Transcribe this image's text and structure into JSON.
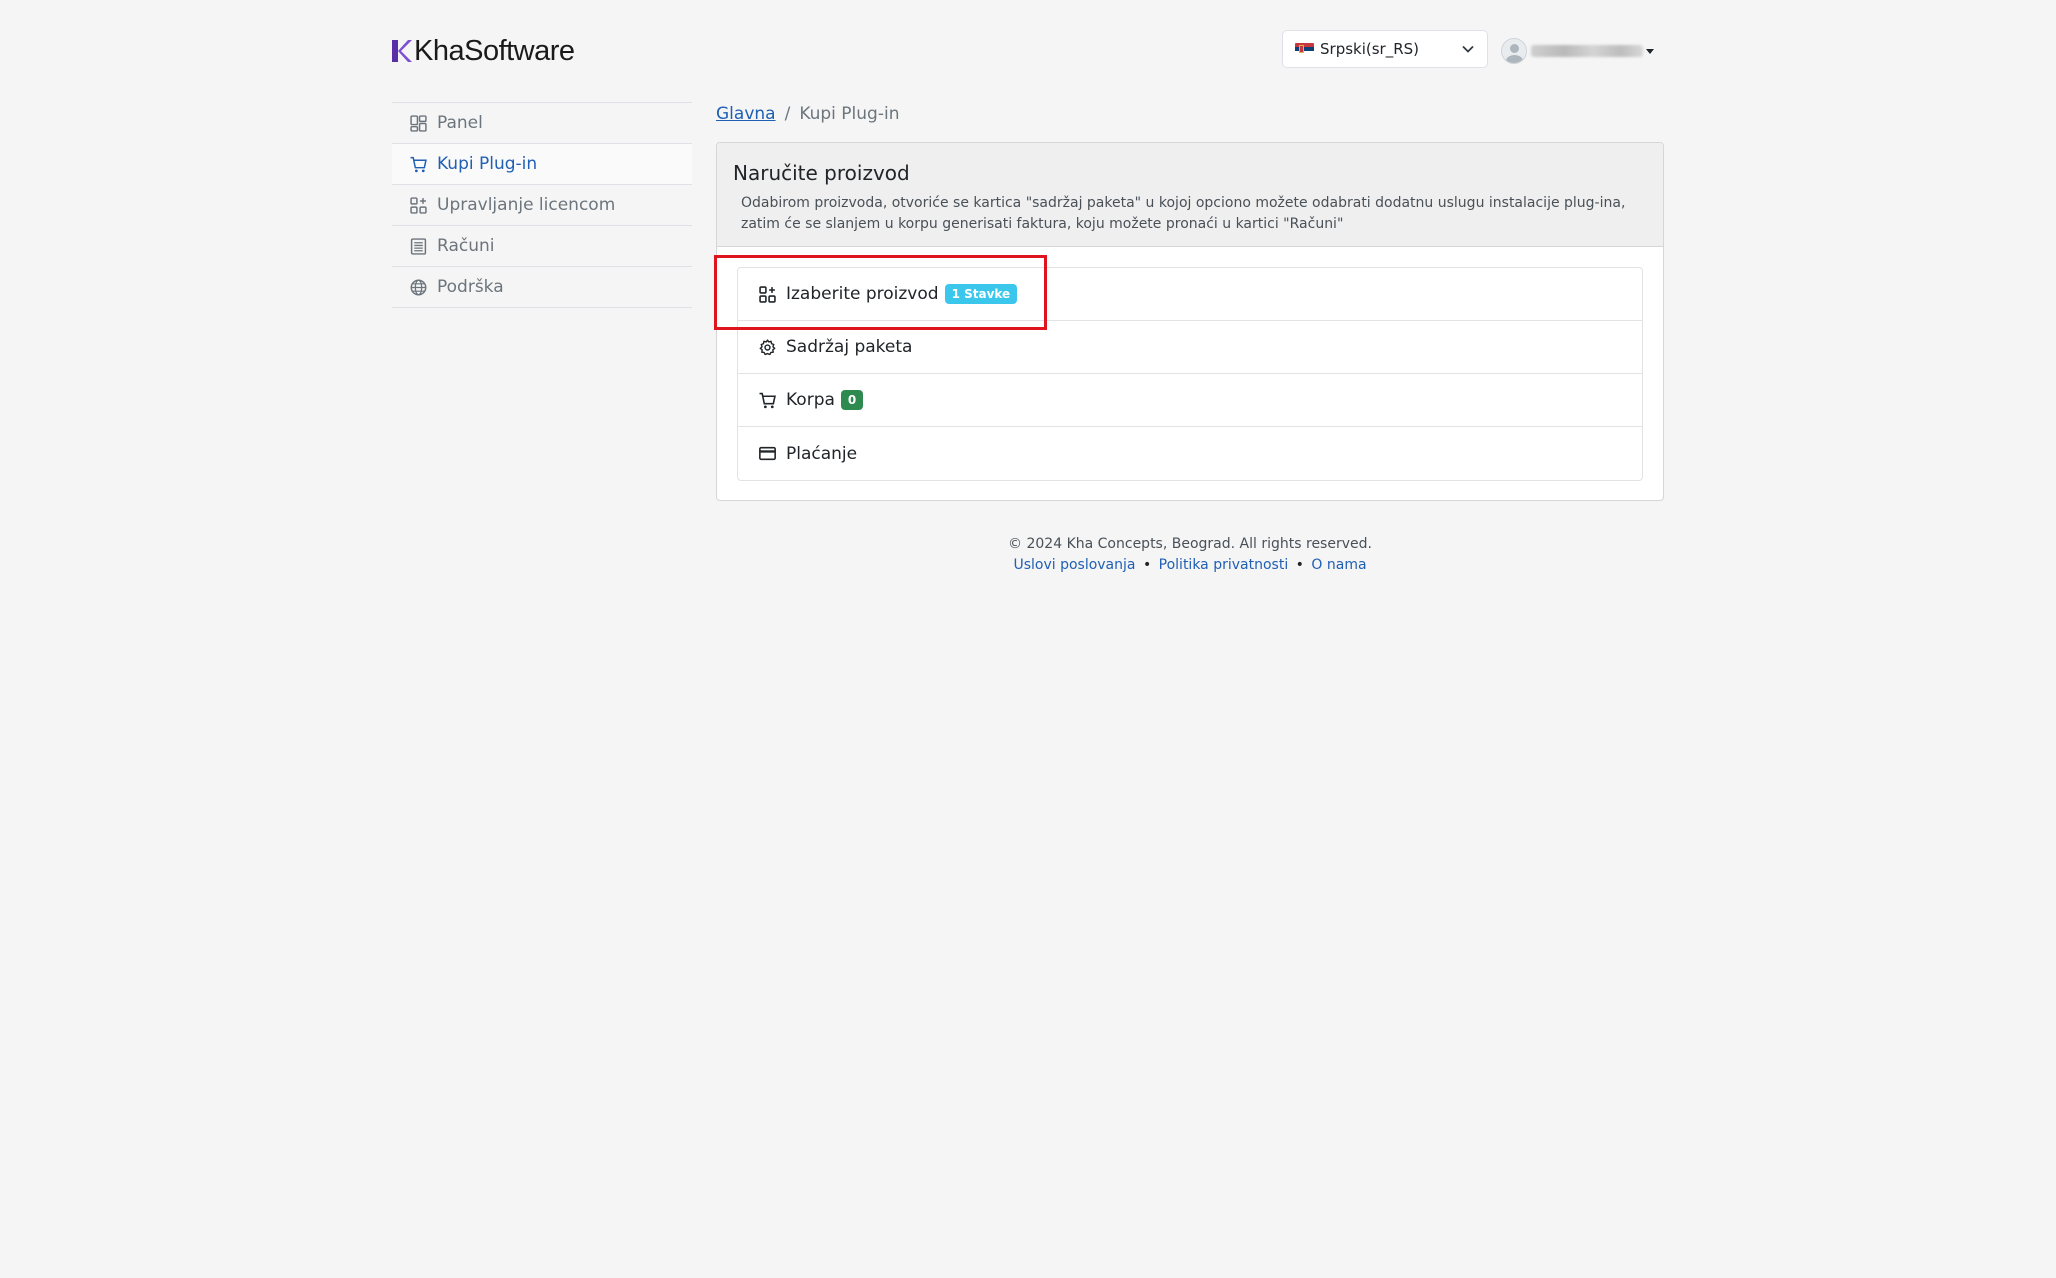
{
  "brand": {
    "name": "KhaSoftware",
    "accent": "#5a2ea6"
  },
  "language": {
    "selected": "Srpski(sr_RS)",
    "icon": "chevron-down-icon",
    "flag": "serbia-flag-icon"
  },
  "user": {
    "avatar_icon": "user-avatar-icon"
  },
  "sidebar": {
    "items": [
      {
        "label": "Panel",
        "icon": "dashboard-icon"
      },
      {
        "label": "Kupi Plug-in",
        "icon": "cart-icon",
        "active": true
      },
      {
        "label": "Upravljanje licencom",
        "icon": "grid-plus-icon"
      },
      {
        "label": "Računi",
        "icon": "list-icon"
      },
      {
        "label": "Podrška",
        "icon": "globe-icon"
      }
    ]
  },
  "breadcrumb": {
    "home": "Glavna",
    "separator": "/",
    "current": "Kupi Plug-in"
  },
  "card": {
    "title": "Naručite proizvod",
    "description": "Odabirom proizvoda, otvoriće se kartica \"sadržaj paketa\" u kojoj opciono možete odabrati dodatnu uslugu instalacije plug-ina, zatim će se slanjem u korpu generisati faktura, koju možete pronaći u kartici \"Računi\""
  },
  "steps": [
    {
      "label": "Izaberite proizvod",
      "badge": "1 Stavke",
      "badge_color": "#3bc6ec",
      "icon": "grid-plus-icon"
    },
    {
      "label": "Sadržaj paketa",
      "icon": "gear-icon"
    },
    {
      "label": "Korpa",
      "badge": "0",
      "badge_color": "#2f8a4f",
      "icon": "cart-icon"
    },
    {
      "label": "Plaćanje",
      "icon": "credit-card-icon"
    }
  ],
  "footer": {
    "copyright": "© 2024 Kha Concepts, Beograd. All rights reserved.",
    "links": [
      "Uslovi poslovanja",
      "Politika privatnosti",
      "O nama"
    ],
    "separator": "•"
  }
}
